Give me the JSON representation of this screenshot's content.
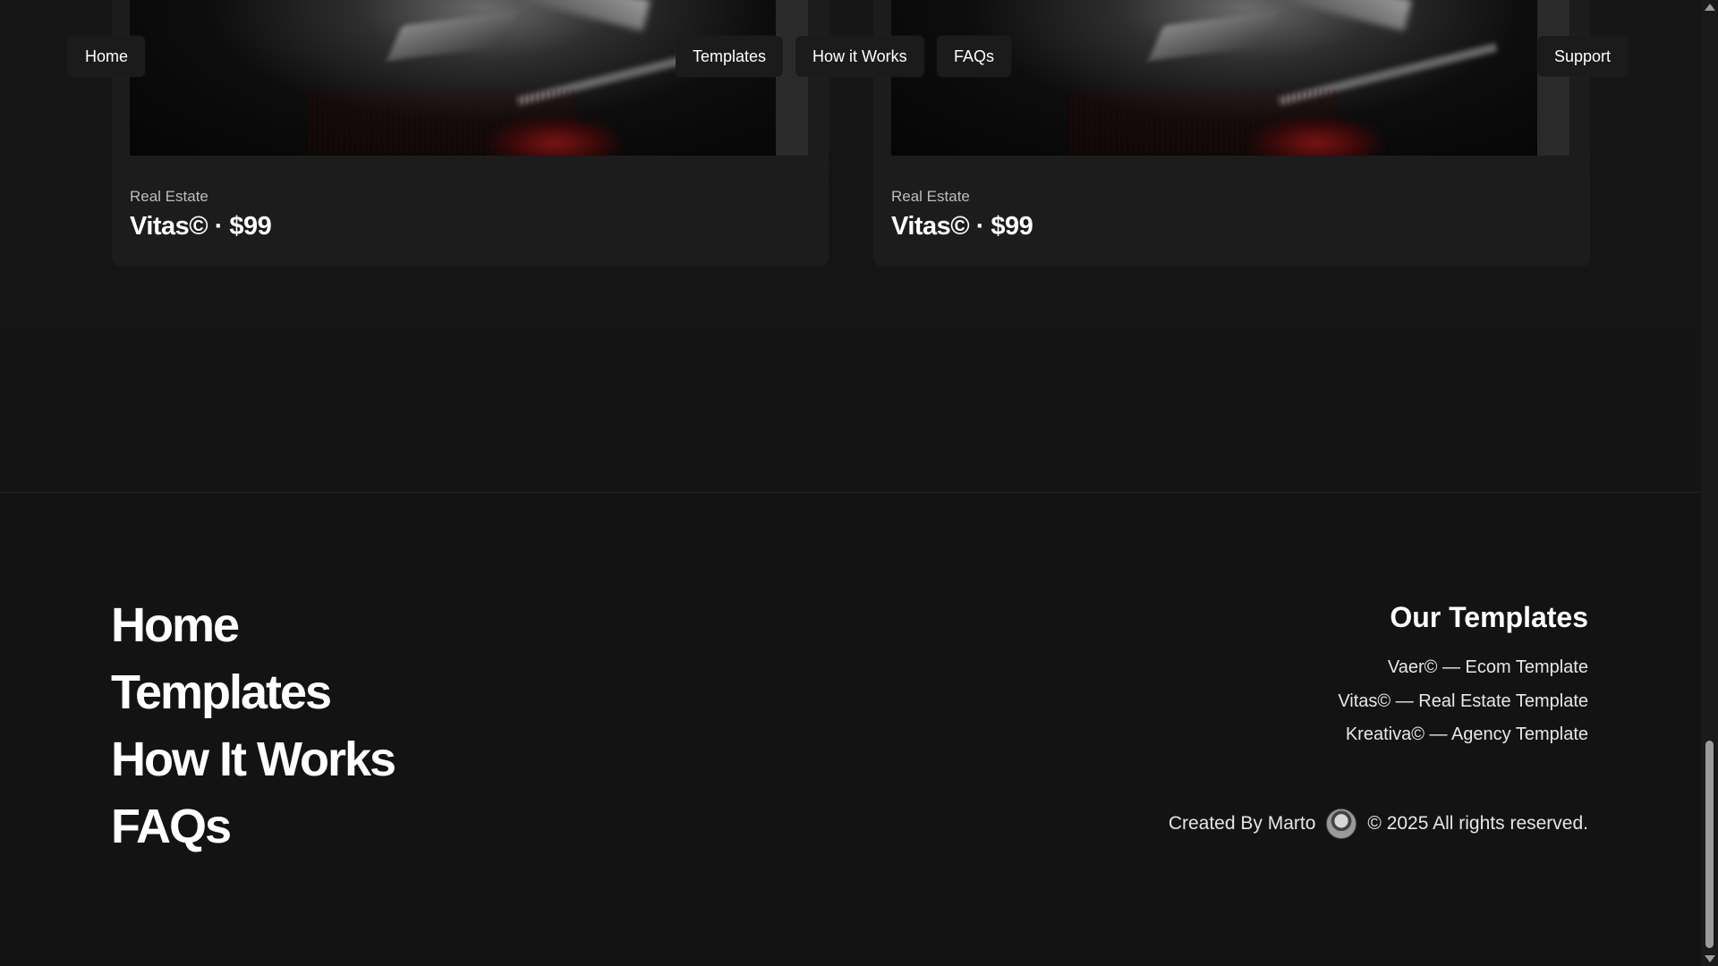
{
  "nav": {
    "home": "Home",
    "templates": "Templates",
    "how_it_works": "How it Works",
    "faqs": "FAQs",
    "support": "Support"
  },
  "cards": [
    {
      "category": "Real Estate",
      "title": "Vitas© · $99"
    },
    {
      "category": "Real Estate",
      "title": "Vitas© · $99"
    }
  ],
  "footer": {
    "links": [
      "Home",
      "Templates",
      "How It Works",
      "FAQs"
    ],
    "templates_heading": "Our Templates",
    "templates": [
      "Vaer© — Ecom Template",
      "Vitas© — Real Estate Template",
      "Kreativa© — Agency Template"
    ],
    "created_by": "Created By Marto",
    "copyright": "© 2025 All rights reserved."
  }
}
